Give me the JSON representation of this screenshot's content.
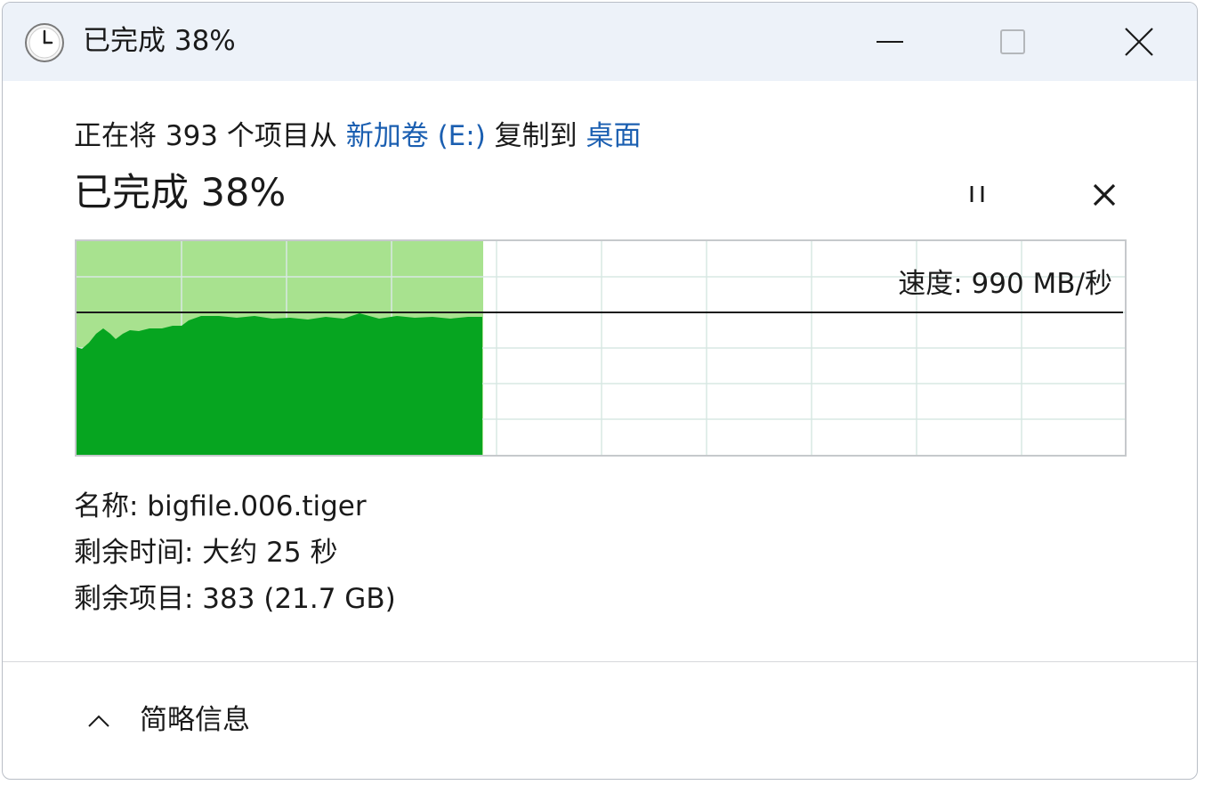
{
  "window": {
    "title": "已完成 38%",
    "icon": "clock-icon"
  },
  "operation": {
    "prefix": "正在将 393 个项目从 ",
    "source": "新加卷 (E:)",
    "middle": " 复制到 ",
    "destination": "桌面"
  },
  "progress": {
    "label": "已完成 38%",
    "fraction": 0.38
  },
  "speed": {
    "label": "速度: 990 MB/秒"
  },
  "details": {
    "name": "名称:  bigfile.006.tiger",
    "time_remaining": "剩余时间:  大约 25 秒",
    "items_remaining": "剩余项目:  383 (21.7 GB)"
  },
  "footer": {
    "toggle_label": "简略信息",
    "icon": "chevron-up-icon"
  },
  "colors": {
    "titlebar_bg": "#edf2f9",
    "link": "#1b5fb1",
    "graph_light": "#a8e28f",
    "graph_dark": "#06a520"
  },
  "icons": {
    "minimize": "minimize-icon",
    "maximize": "maximize-icon",
    "close": "close-icon",
    "pause": "pause-icon",
    "cancel": "cancel-icon"
  }
}
